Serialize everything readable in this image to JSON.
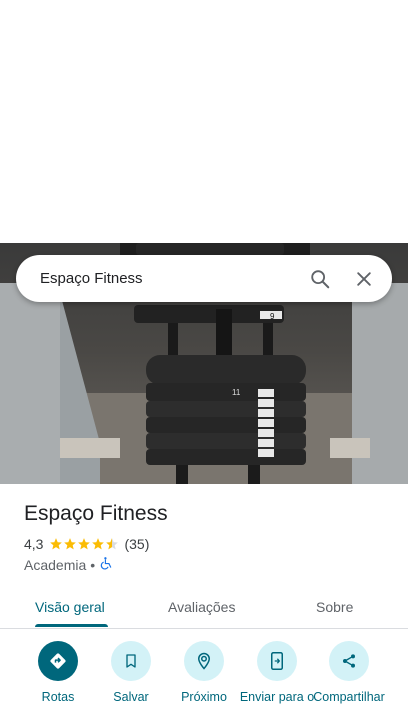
{
  "search": {
    "query": "Espaço Fitness"
  },
  "place": {
    "name": "Espaço Fitness",
    "rating": "4,3",
    "stars": 4.3,
    "reviews_count": "(35)",
    "category": "Academia",
    "separator": "•"
  },
  "photo": {
    "plate_numbers": [
      "9",
      "11"
    ]
  },
  "tabs": [
    {
      "label": "Visão geral",
      "active": true
    },
    {
      "label": "Avaliações",
      "active": false
    },
    {
      "label": "Sobre",
      "active": false
    }
  ],
  "actions": [
    {
      "label": "Rotas",
      "icon": "directions-icon"
    },
    {
      "label": "Salvar",
      "icon": "bookmark-icon"
    },
    {
      "label": "Próximo",
      "icon": "nearby-icon"
    },
    {
      "label": "Enviar para o",
      "icon": "send-to-phone-icon"
    },
    {
      "label": "Compartilhar",
      "icon": "share-icon"
    }
  ],
  "colors": {
    "accent": "#00677c",
    "accent_light": "#d3f2f7",
    "star": "#fbbc04",
    "accessible": "#1a73e8"
  }
}
